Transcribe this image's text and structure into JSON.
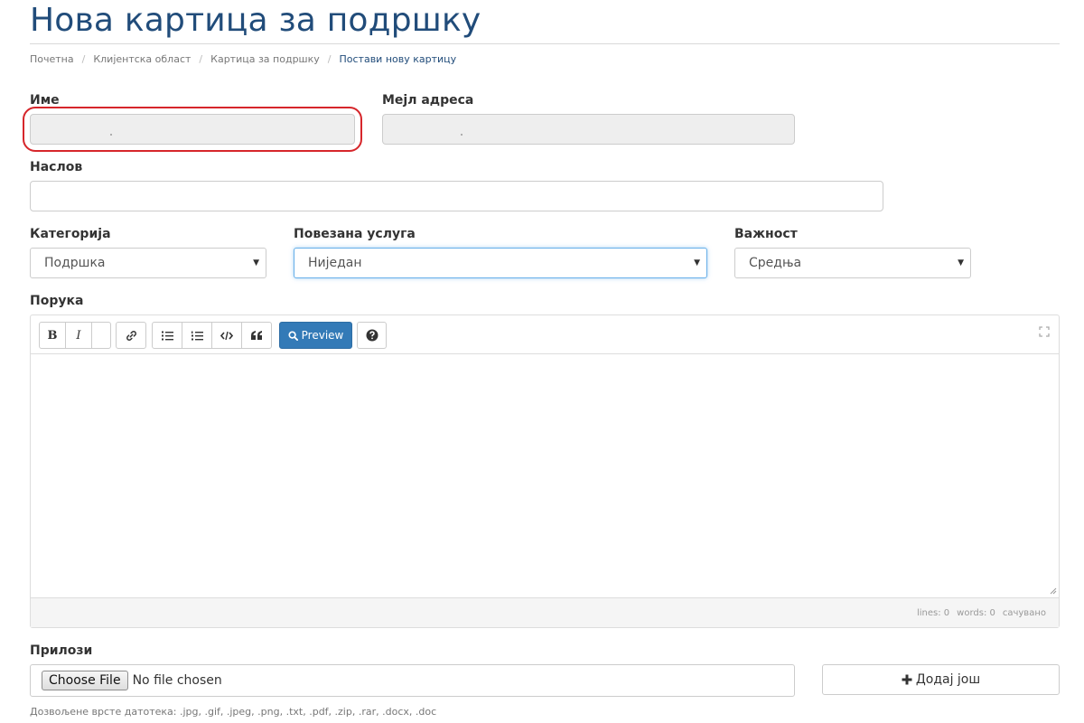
{
  "page": {
    "title": "Нова картица за подршку"
  },
  "breadcrumb": [
    {
      "label": "Почетна"
    },
    {
      "label": "Клијентска област"
    },
    {
      "label": "Картица за подршку"
    },
    {
      "label": "Постави нову картицу"
    }
  ],
  "form": {
    "name": {
      "label": "Име",
      "value": ""
    },
    "email": {
      "label": "Мејл адреса",
      "value": ""
    },
    "subject": {
      "label": "Наслов",
      "value": ""
    },
    "category": {
      "label": "Категорија",
      "selected": "Подршка"
    },
    "related_service": {
      "label": "Повезана услуга",
      "selected": "Ниједан"
    },
    "priority": {
      "label": "Важност",
      "selected": "Средња"
    },
    "message": {
      "label": "Порука",
      "value": ""
    }
  },
  "editor": {
    "toolbar": {
      "bold": "B",
      "italic": "I",
      "preview_label": "Preview"
    },
    "status": {
      "lines": "lines: 0",
      "words": "words: 0",
      "saved": "сачувано"
    }
  },
  "attachments": {
    "label": "Прилози",
    "choose_file": "Choose File",
    "no_file": "No file chosen",
    "add_more": "Додај још",
    "allowed_types": "Дозвољене врсте датотека: .jpg, .gif, .jpeg, .png, .txt, .pdf, .zip, .rar, .docx, .doc"
  },
  "colors": {
    "title": "#214c7a",
    "primary_button": "#337ab7",
    "highlight_ring": "#d6262b",
    "focus": "#66afe9"
  },
  "icons": {
    "link": "link-icon",
    "unordered_list": "list-ul-icon",
    "ordered_list": "list-ol-icon",
    "code": "code-icon",
    "quote": "quote-icon",
    "preview": "search-icon",
    "help": "question-circle-icon",
    "fullscreen": "fullscreen-icon",
    "add": "plus-icon"
  }
}
